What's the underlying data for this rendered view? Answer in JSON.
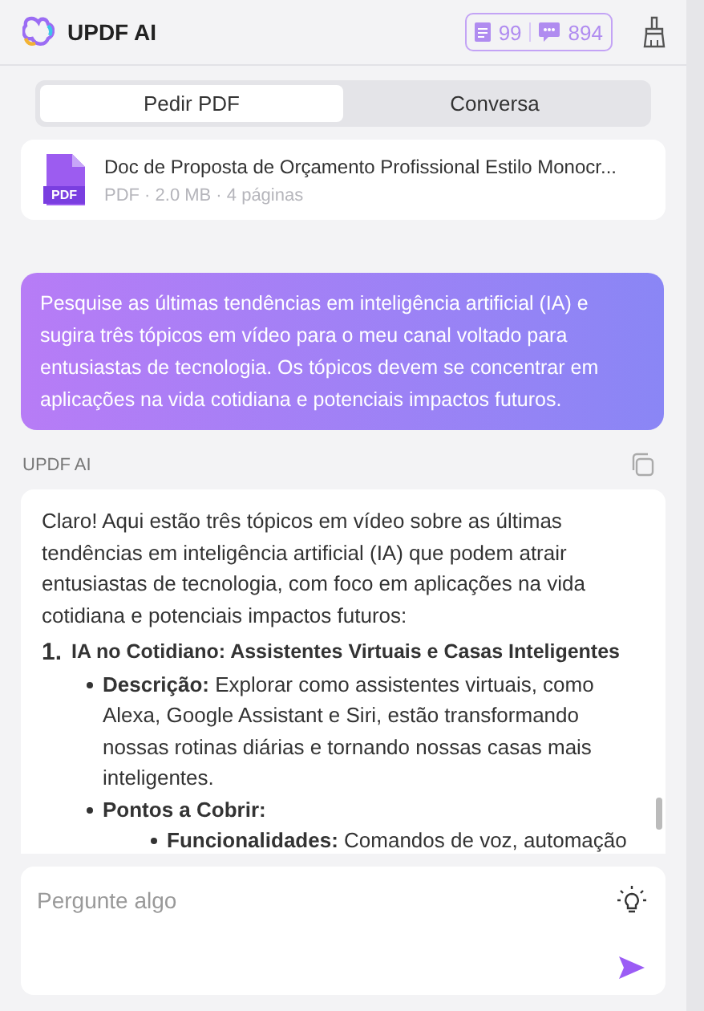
{
  "header": {
    "title": "UPDF AI",
    "counts": [
      {
        "kind": "pdf",
        "value": "99"
      },
      {
        "kind": "chat",
        "value": "894"
      }
    ]
  },
  "tabs": [
    {
      "label": "Pedir PDF",
      "selected": true
    },
    {
      "label": "Conversa",
      "selected": false
    }
  ],
  "document": {
    "name": "Doc de Proposta de Orçamento Profissional Estilo Monocr...",
    "meta": "PDF · 2.0 MB · 4 páginas",
    "badge": "PDF"
  },
  "user_message": "Pesquise as últimas tendências em inteligência artificial (IA) e sugira três tópicos em vídeo para o meu canal voltado para entusiastas de tecnologia. Os tópicos devem se concentrar em aplicações na vida cotidiana e potenciais impactos futuros.",
  "assistant": {
    "name": "UPDF AI",
    "intro": "Claro! Aqui estão três tópicos em vídeo sobre as últimas tendências em inteligência artificial (IA) que podem atrair entusiastas de tecnologia, com foco em aplicações na vida cotidiana e potenciais impactos futuros:",
    "sections": [
      {
        "number": "1.",
        "title": "IA no Cotidiano: Assistentes Virtuais e Casas Inteligentes",
        "points": [
          {
            "text": "**Descrição:** Explorar como assistentes virtuais, como Alexa, Google Assistant e Siri, estão transformando nossas rotinas diárias e tornando nossas casas mais inteligentes."
          },
          {
            "text": "**Pontos a Cobrir:**",
            "children": [
              {
                "text": "**Funcionalidades:** Comandos de voz, automação"
              }
            ]
          }
        ]
      }
    ]
  },
  "input": {
    "placeholder": "Pergunte algo"
  }
}
